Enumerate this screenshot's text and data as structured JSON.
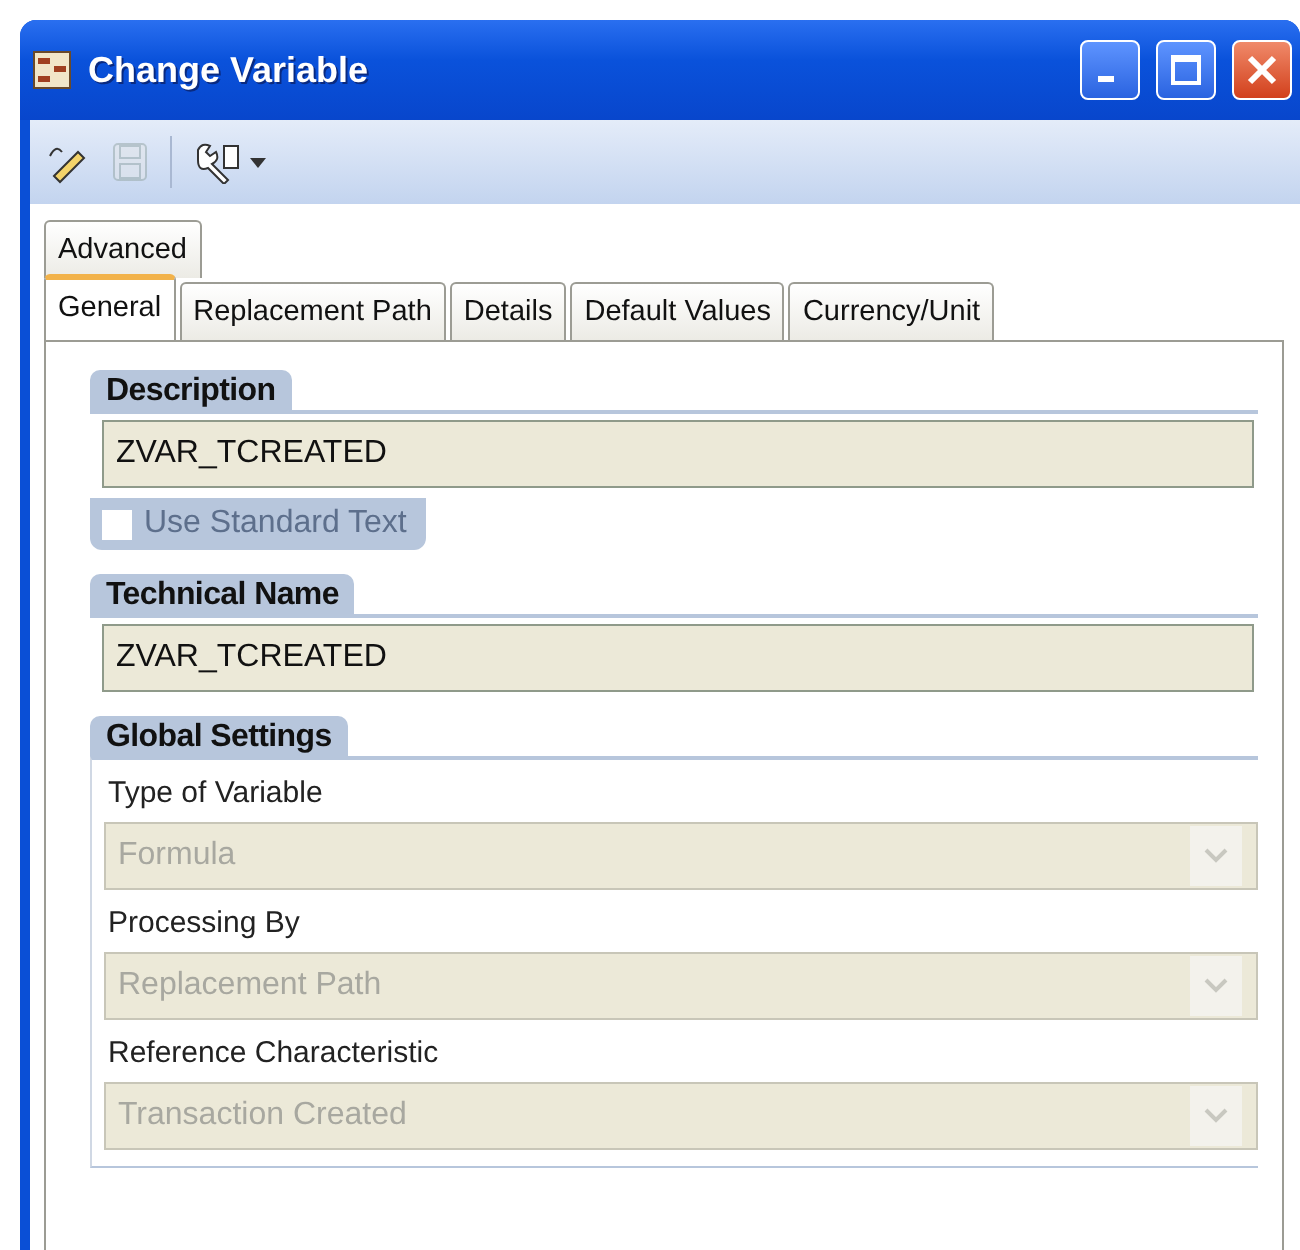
{
  "window": {
    "title": "Change Variable"
  },
  "toolbar": [
    {
      "kind": "edit",
      "disabled": false
    },
    {
      "kind": "save",
      "disabled": true
    },
    {
      "kind": "separator"
    },
    {
      "kind": "tools",
      "disabled": false
    }
  ],
  "tab_rows": [
    [
      {
        "label": "Advanced",
        "selected": false
      }
    ],
    [
      {
        "label": "General",
        "selected": true
      },
      {
        "label": "Replacement Path",
        "selected": false
      },
      {
        "label": "Details",
        "selected": false
      },
      {
        "label": "Default Values",
        "selected": false
      },
      {
        "label": "Currency/Unit",
        "selected": false
      }
    ]
  ],
  "sections": [
    {
      "title": "Description",
      "fields": [
        {
          "kind": "text",
          "value": "ZVAR_TCREATED",
          "disabled": false
        },
        {
          "kind": "checkbox",
          "label": "Use Standard Text",
          "checked": false,
          "disabled": true
        }
      ]
    },
    {
      "title": "Technical Name",
      "fields": [
        {
          "kind": "text",
          "value": "ZVAR_TCREATED",
          "disabled": false
        }
      ]
    },
    {
      "title": "Global Settings",
      "fields": [
        {
          "kind": "combo",
          "label": "Type of Variable",
          "value": "Formula",
          "disabled": true
        },
        {
          "kind": "combo",
          "label": "Processing By",
          "value": "Replacement Path",
          "disabled": true
        },
        {
          "kind": "combo",
          "label": "Reference Characteristic",
          "value": "Transaction Created",
          "disabled": true
        }
      ]
    }
  ]
}
